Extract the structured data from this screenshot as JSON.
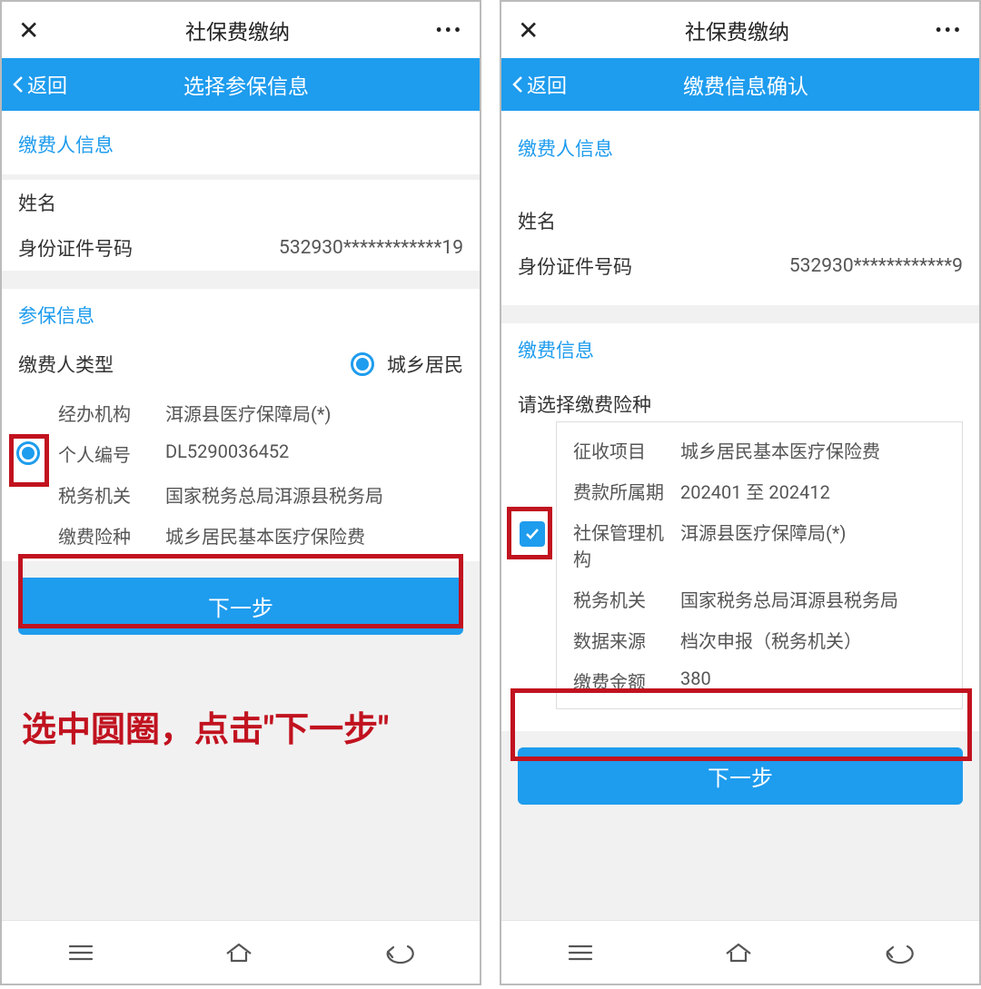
{
  "annotation_left": "选中圆圈，点击\"下一步\"",
  "left": {
    "titlebar": {
      "close": "✕",
      "title": "社保费缴纳",
      "more": "•••"
    },
    "bluebar": {
      "back": "返回",
      "title": "选择参保信息"
    },
    "payer_section": {
      "header": "缴费人信息",
      "name_label": "姓名",
      "name_value": "   ",
      "id_label": "身份证件号码",
      "id_value": "532930************19"
    },
    "insure_section": {
      "header": "参保信息",
      "type_label": "缴费人类型",
      "type_value": "城乡居民",
      "detail": {
        "org_label": "经办机构",
        "org_value": "洱源县医疗保障局(*)",
        "pid_label": "个人编号",
        "pid_value": "DL5290036452",
        "tax_label": "税务机关",
        "tax_value": "国家税务总局洱源县税务局",
        "ins_label": "缴费险种",
        "ins_value": "城乡居民基本医疗保险费"
      }
    },
    "next_btn": "下一步"
  },
  "right": {
    "titlebar": {
      "close": "✕",
      "title": "社保费缴纳",
      "more": "•••"
    },
    "bluebar": {
      "back": "返回",
      "title": "缴费信息确认"
    },
    "payer_section": {
      "header": "缴费人信息",
      "name_label": "姓名",
      "name_value": "   ",
      "id_label": "身份证件号码",
      "id_value": "532930************9"
    },
    "fee_section": {
      "header": "缴费信息",
      "select_label": "请选择缴费险种",
      "detail": {
        "item_label": "征收项目",
        "item_value": "城乡居民基本医疗保险费",
        "period_label": "费款所属期",
        "period_value": "202401 至 202412",
        "mgmt_label": "社保管理机构",
        "mgmt_value": "洱源县医疗保障局(*)",
        "tax_label": "税务机关",
        "tax_value": "国家税务总局洱源县税务局",
        "src_label": "数据来源",
        "src_value": "档次申报（税务机关）",
        "amt_label": "缴费金额",
        "amt_value": "380"
      }
    },
    "next_btn": "下一步"
  }
}
